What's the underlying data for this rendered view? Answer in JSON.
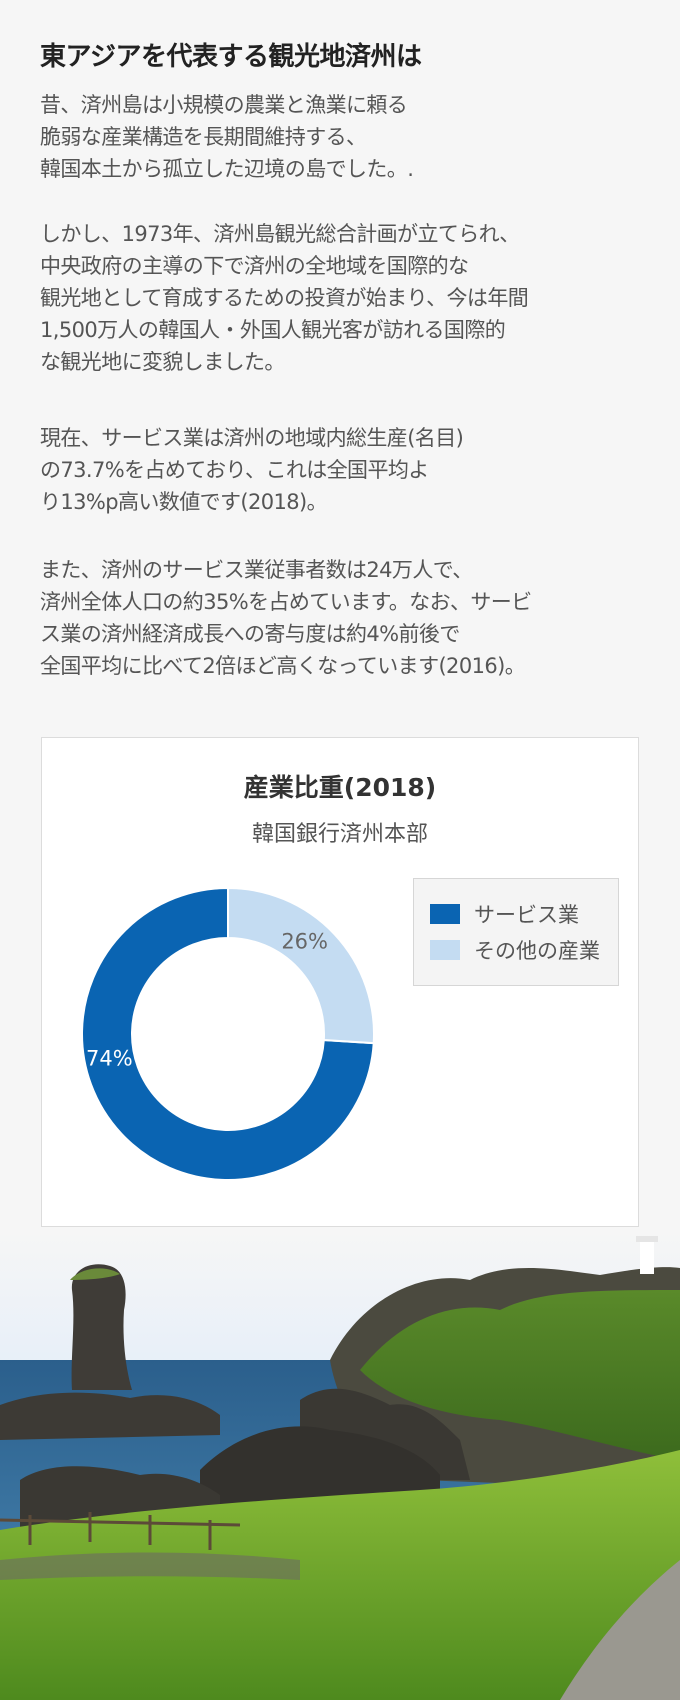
{
  "article": {
    "title": "東アジアを代表する観光地済州は",
    "paragraphs": [
      [
        "昔、済州島は小規模の農業と漁業に頼る",
        "脆弱な産業構造を長期間維持する、",
        "韓国本土から孤立した辺境の島でした。."
      ],
      [
        "しかし、1973年、済州島観光総合計画が立てられ、",
        "中央政府の主導の下で済州の全地域を国際的な",
        "観光地として育成するための投資が始まり、今は年間",
        "1,500万人の韓国人・外国人観光客が訪れる国際的",
        "な観光地に変貌しました。"
      ],
      [
        "現在、サービス業は済州の地域内総生産(名目)",
        "の73.7%を占めており、これは全国平均よ",
        "り13%p高い数値です(2018)。"
      ],
      [
        "また、済州のサービス業従事者数は24万人で、",
        "済州全体人口の約35%を占めています。なお、サービ",
        "ス業の済州経済成長への寄与度は約4%前後で",
        "全国平均に比べて2倍ほど高くなっています(2016)。"
      ]
    ]
  },
  "chart_data": {
    "type": "pie",
    "title": "産業比重(2018)",
    "subtitle": "韓国銀行済州本部",
    "categories": [
      "サービス業",
      "その他の産業"
    ],
    "values": [
      74,
      26
    ],
    "labels": [
      "74%",
      "26%"
    ],
    "colors": [
      "#0a64b2",
      "#c4dcf2"
    ],
    "legend_position": "right"
  },
  "photo": {
    "icon": "coastal-landscape-photo"
  }
}
